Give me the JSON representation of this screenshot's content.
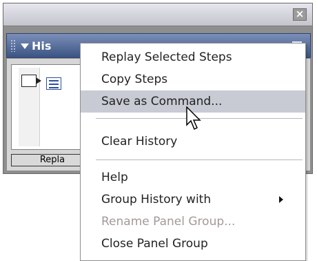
{
  "panel": {
    "title": "His",
    "close_symbol": "×",
    "replay_button_label": "Repla"
  },
  "context_menu": {
    "items": [
      {
        "label": "Replay Selected Steps",
        "state": "normal"
      },
      {
        "label": "Copy Steps",
        "state": "normal"
      },
      {
        "label": "Save as Command...",
        "state": "highlighted"
      },
      {
        "label": "Clear History",
        "state": "normal"
      },
      {
        "label": "Help",
        "state": "normal"
      },
      {
        "label": "Group History with",
        "state": "normal",
        "has_submenu": true
      },
      {
        "label": "Rename Panel Group...",
        "state": "disabled"
      },
      {
        "label": "Close Panel Group",
        "state": "normal"
      }
    ]
  },
  "icons": {
    "close": "close-icon",
    "grip": "grip-icon",
    "collapse": "triangle-down-icon",
    "options": "options-menu-icon",
    "slider": "history-slider-icon",
    "step": "step-icon",
    "save": "save-icon",
    "cursor": "mouse-pointer-icon",
    "submenu": "chevron-right-icon"
  }
}
